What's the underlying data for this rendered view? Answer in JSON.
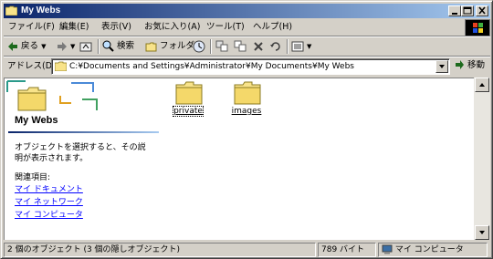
{
  "window": {
    "title": "My Webs",
    "buttons": {
      "minimize": "_",
      "maximize": "□",
      "close": "×"
    }
  },
  "menu": {
    "items": [
      "ファイル(F)",
      "編集(E)",
      "表示(V)",
      "お気に入り(A)",
      "ツール(T)",
      "ヘルプ(H)"
    ]
  },
  "toolbar": {
    "back": "戻る",
    "search": "検索",
    "folders": "フォルダ",
    "icons": [
      "back-arrow-icon",
      "forward-arrow-icon",
      "up-folder-icon",
      "search-icon",
      "folders-icon",
      "history-icon",
      "move-to-icon",
      "copy-to-icon",
      "delete-icon",
      "undo-icon",
      "views-icon"
    ]
  },
  "address": {
    "label": "アドレス(D)",
    "value": "C:¥Documents and Settings¥Administrator¥My Documents¥My Webs",
    "go": "移動"
  },
  "panel": {
    "title": "My Webs",
    "description": "オブジェクトを選択すると、その説明が表示されます。",
    "related_label": "関連項目:",
    "links": [
      "マイ ドキュメント",
      "マイ ネットワーク",
      "マイ コンピュータ"
    ]
  },
  "files": [
    {
      "name": "private",
      "selected": true
    },
    {
      "name": "images",
      "selected": false
    }
  ],
  "status": {
    "objects": "2 個のオブジェクト (3 個の隠しオブジェクト)",
    "size": "789 バイト",
    "location": "マイ コンピュータ"
  },
  "colors": {
    "titlebar_start": "#0a246a",
    "titlebar_end": "#a6caf0",
    "face": "#d4d0c8",
    "link": "#0000ff"
  }
}
